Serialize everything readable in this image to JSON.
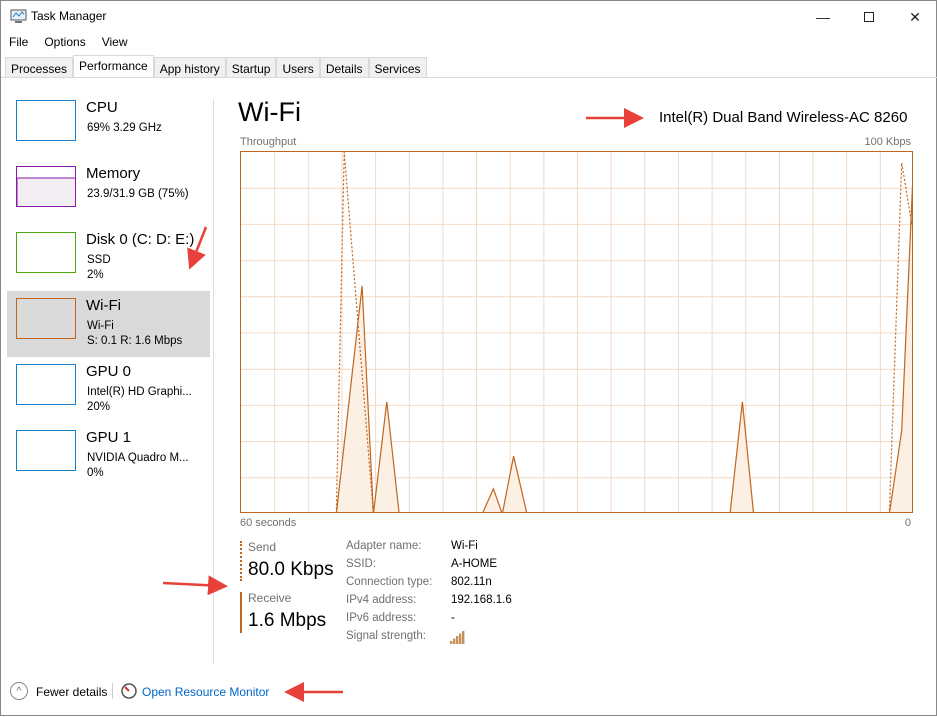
{
  "window": {
    "title": "Task Manager",
    "icon": "task-manager-icon",
    "controls": [
      "minimize-icon",
      "maximize-icon",
      "close-icon"
    ]
  },
  "menu": [
    "File",
    "Options",
    "View"
  ],
  "tabs": [
    {
      "label": "Processes"
    },
    {
      "label": "Performance",
      "active": true
    },
    {
      "label": "App history"
    },
    {
      "label": "Startup"
    },
    {
      "label": "Users"
    },
    {
      "label": "Details"
    },
    {
      "label": "Services"
    }
  ],
  "sidebar": [
    {
      "name": "CPU",
      "line1": "69% 3.29 GHz",
      "line2": "",
      "color": "#1a7fc2"
    },
    {
      "name": "Memory",
      "line1": "23.9/31.9 GB (75%)",
      "line2": "",
      "color": "#8b1aa8"
    },
    {
      "name": "Disk 0 (C: D: E:)",
      "line1": "SSD",
      "line2": "2%",
      "color": "#4da70d"
    },
    {
      "name": "Wi-Fi",
      "line1": "Wi-Fi",
      "line2": "S: 0.1 R: 1.6 Mbps",
      "color": "#c0661e",
      "selected": true
    },
    {
      "name": "GPU 0",
      "line1": "Intel(R) HD Graphi...",
      "line2": "20%",
      "color": "#1a7fc2"
    },
    {
      "name": "GPU 1",
      "line1": "NVIDIA Quadro M...",
      "line2": "0%",
      "color": "#1a7fc2"
    }
  ],
  "main": {
    "title": "Wi-Fi",
    "adapter": "Intel(R) Dual Band Wireless-AC 8260",
    "graph_label": "Throughput",
    "graph_max": "100 Kbps",
    "x_left": "60 seconds",
    "x_right": "0",
    "send": {
      "label": "Send",
      "value": "80.0 Kbps"
    },
    "receive": {
      "label": "Receive",
      "value": "1.6 Mbps"
    },
    "details": [
      {
        "k": "Adapter name:",
        "v": "Wi-Fi"
      },
      {
        "k": "SSID:",
        "v": "A-HOME"
      },
      {
        "k": "Connection type:",
        "v": "802.11n"
      },
      {
        "k": "IPv4 address:",
        "v": "192.168.1.6"
      },
      {
        "k": "IPv6 address:",
        "v": "-"
      },
      {
        "k": "Signal strength:",
        "v": ""
      }
    ],
    "signal_bars": 5
  },
  "chart_data": {
    "type": "line",
    "title": "Throughput",
    "xlabel": "",
    "ylabel": "",
    "xlim": [
      60,
      0
    ],
    "ylim": [
      0,
      100
    ],
    "x_unit": "seconds ago",
    "y_unit": "Kbps",
    "grid": true,
    "series": [
      {
        "name": "Receive",
        "style": "solid",
        "points": [
          [
            60,
            0
          ],
          [
            51.5,
            0
          ],
          [
            49.2,
            63
          ],
          [
            48.2,
            0
          ],
          [
            47,
            31
          ],
          [
            45.9,
            0
          ],
          [
            38.5,
            0
          ],
          [
            37.5,
            7
          ],
          [
            36.7,
            0
          ],
          [
            35.7,
            16
          ],
          [
            34.5,
            0
          ],
          [
            16.4,
            0
          ],
          [
            15.3,
            31
          ],
          [
            14.3,
            0
          ],
          [
            2.2,
            0
          ],
          [
            1.1,
            23
          ],
          [
            0,
            100
          ]
        ]
      },
      {
        "name": "Send",
        "style": "dashed",
        "points": [
          [
            60,
            0
          ],
          [
            51.5,
            0
          ],
          [
            50.8,
            100
          ],
          [
            48.2,
            0
          ],
          [
            2.2,
            0
          ],
          [
            1.1,
            97
          ],
          [
            0.2,
            80
          ],
          [
            0,
            85
          ]
        ]
      }
    ]
  },
  "footer": {
    "fewer": "Fewer details",
    "monitor": "Open Resource Monitor"
  },
  "colors": {
    "accent": "#c0661e",
    "link": "#0066cc",
    "grid": "#f3d9c4",
    "annotation_arrow": "#e8413a"
  }
}
